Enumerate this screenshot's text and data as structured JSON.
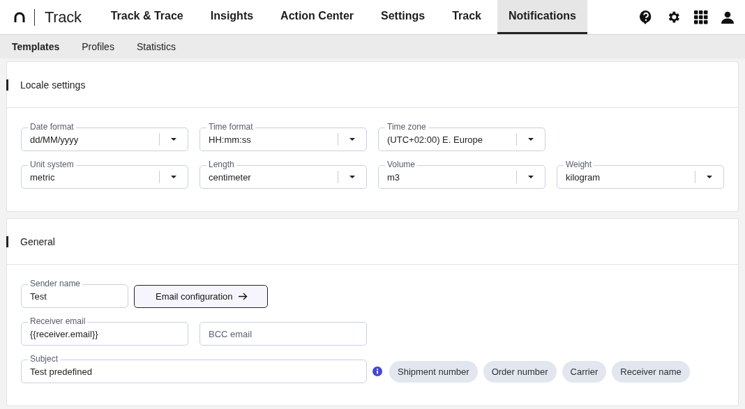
{
  "app": {
    "name": "Track"
  },
  "nav": [
    {
      "label": "Track & Trace",
      "selected": false
    },
    {
      "label": "Insights",
      "selected": false
    },
    {
      "label": "Action Center",
      "selected": false
    },
    {
      "label": "Settings",
      "selected": false
    },
    {
      "label": "Track",
      "selected": false
    },
    {
      "label": "Notifications",
      "selected": true
    }
  ],
  "subnav": [
    {
      "label": "Templates",
      "selected": true
    },
    {
      "label": "Profiles",
      "selected": false
    },
    {
      "label": "Statistics",
      "selected": false
    }
  ],
  "sections": [
    {
      "title": "Locale settings",
      "rows": [
        [
          {
            "kind": "select",
            "label": "Date format",
            "value": "dd/MM/yyyy"
          },
          {
            "kind": "select",
            "label": "Time format",
            "value": "HH:mm:ss"
          },
          {
            "kind": "select",
            "label": "Time zone",
            "value": "(UTC+02:00) E. Europe"
          }
        ],
        [
          {
            "kind": "select",
            "label": "Unit system",
            "value": "metric"
          },
          {
            "kind": "select",
            "label": "Length",
            "value": "centimeter"
          },
          {
            "kind": "select",
            "label": "Volume",
            "value": "m3"
          },
          {
            "kind": "select",
            "label": "Weight",
            "value": "kilogram"
          }
        ]
      ]
    },
    {
      "title": "General",
      "rows": [
        [
          {
            "kind": "short-text",
            "label": "Sender name",
            "value": "Test"
          },
          {
            "kind": "button",
            "label": "Email configuration"
          }
        ],
        [
          {
            "kind": "text",
            "label": "Receiver email",
            "value": "{{receiver.email}}"
          },
          {
            "kind": "text",
            "placeholder": "BCC email"
          }
        ],
        [
          {
            "kind": "wide-text",
            "label": "Subject",
            "value": "Test predefined"
          },
          {
            "kind": "info"
          },
          {
            "kind": "chip",
            "label": "Shipment number"
          },
          {
            "kind": "chip",
            "label": "Order number"
          },
          {
            "kind": "chip",
            "label": "Carrier"
          },
          {
            "kind": "chip",
            "label": "Receiver name"
          }
        ]
      ]
    }
  ]
}
